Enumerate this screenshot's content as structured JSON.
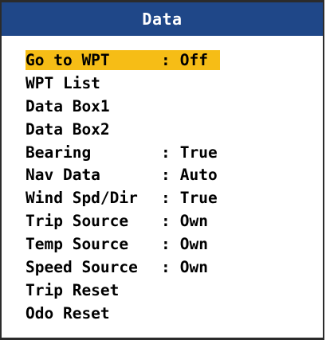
{
  "window": {
    "title": "Data"
  },
  "menu": {
    "items": [
      {
        "label": "Go to WPT",
        "value": "Off",
        "selected": true
      },
      {
        "label": "WPT List",
        "value": ""
      },
      {
        "label": "Data Box1",
        "value": ""
      },
      {
        "label": "Data Box2",
        "value": ""
      },
      {
        "label": "Bearing",
        "value": "True"
      },
      {
        "label": "Nav Data",
        "value": "Auto"
      },
      {
        "label": "Wind Spd/Dir",
        "value": "True"
      },
      {
        "label": "Trip Source",
        "value": "Own"
      },
      {
        "label": "Temp Source",
        "value": "Own"
      },
      {
        "label": "Speed Source",
        "value": "Own"
      },
      {
        "label": "Trip Reset",
        "value": ""
      },
      {
        "label": "Odo Reset",
        "value": ""
      }
    ],
    "separator": ":"
  },
  "colors": {
    "title_bg": "#1f4788",
    "title_text": "#ffffff",
    "highlight": "#f6bd16",
    "text": "#000000",
    "border": "#2b2b2b"
  }
}
